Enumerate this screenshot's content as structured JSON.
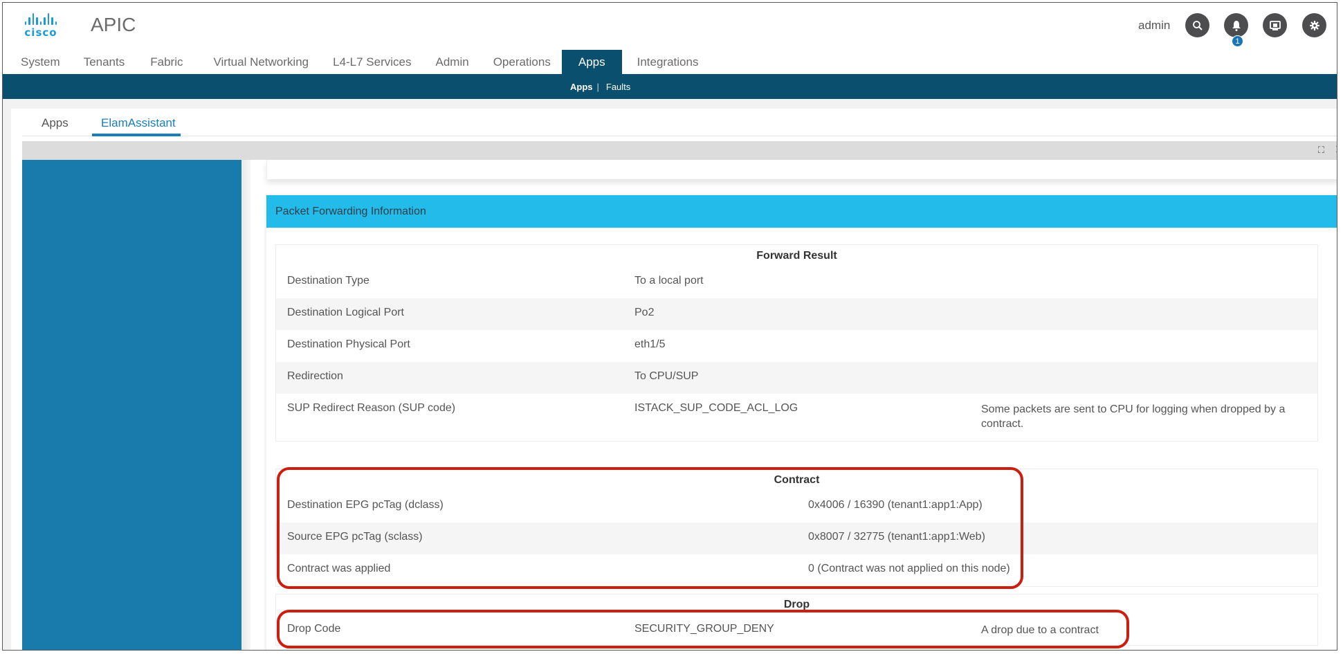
{
  "header": {
    "brand": "cisco",
    "app_title": "APIC",
    "user": "admin",
    "icons": [
      "search-icon",
      "bell-icon",
      "screen-icon",
      "gear-icon"
    ],
    "notification_count": "1"
  },
  "main_nav": {
    "items": [
      "System",
      "Tenants",
      "Fabric",
      "Virtual Networking",
      "L4-L7 Services",
      "Admin",
      "Operations",
      "Apps",
      "Integrations"
    ],
    "active": "Apps"
  },
  "sub_nav": {
    "items": [
      "Apps",
      "Faults"
    ],
    "separator": "|",
    "active": "Apps"
  },
  "app_tabs": {
    "items": [
      "Apps",
      "ElamAssistant"
    ],
    "active": "ElamAssistant"
  },
  "frame_controls": {
    "expand": "⛶",
    "close": "✕"
  },
  "panel": {
    "title": "Packet Forwarding Information",
    "forward_result": {
      "title": "Forward Result",
      "rows": [
        {
          "label": "Destination Type",
          "value": "To a local port",
          "note": ""
        },
        {
          "label": "Destination Logical Port",
          "value": "Po2",
          "note": ""
        },
        {
          "label": "Destination Physical Port",
          "value": "eth1/5",
          "note": ""
        },
        {
          "label": "Redirection",
          "value": "To CPU/SUP",
          "note": ""
        },
        {
          "label": "SUP Redirect Reason (SUP code)",
          "value": "ISTACK_SUP_CODE_ACL_LOG",
          "note": "Some packets are sent to CPU for logging when dropped by a contract."
        }
      ]
    },
    "contract": {
      "title": "Contract",
      "rows": [
        {
          "label": "Destination EPG pcTag (dclass)",
          "value": "0x4006 / 16390 (tenant1:app1:App)"
        },
        {
          "label": "Source EPG pcTag (sclass)",
          "value": "0x8007 / 32775 (tenant1:app1:Web)"
        },
        {
          "label": "Contract was applied",
          "value": "0 (Contract was not applied on this node)"
        }
      ]
    },
    "drop": {
      "title": "Drop",
      "rows": [
        {
          "label": "Drop Code",
          "value": "SECURITY_GROUP_DENY",
          "note": "A drop due to a contract"
        }
      ]
    }
  },
  "colors": {
    "nav_dark": "#0b4f6e",
    "sidebar": "#187bab",
    "panel_header": "#22bbea",
    "highlight": "#cc1e0e",
    "accent": "#1a7fb8"
  }
}
